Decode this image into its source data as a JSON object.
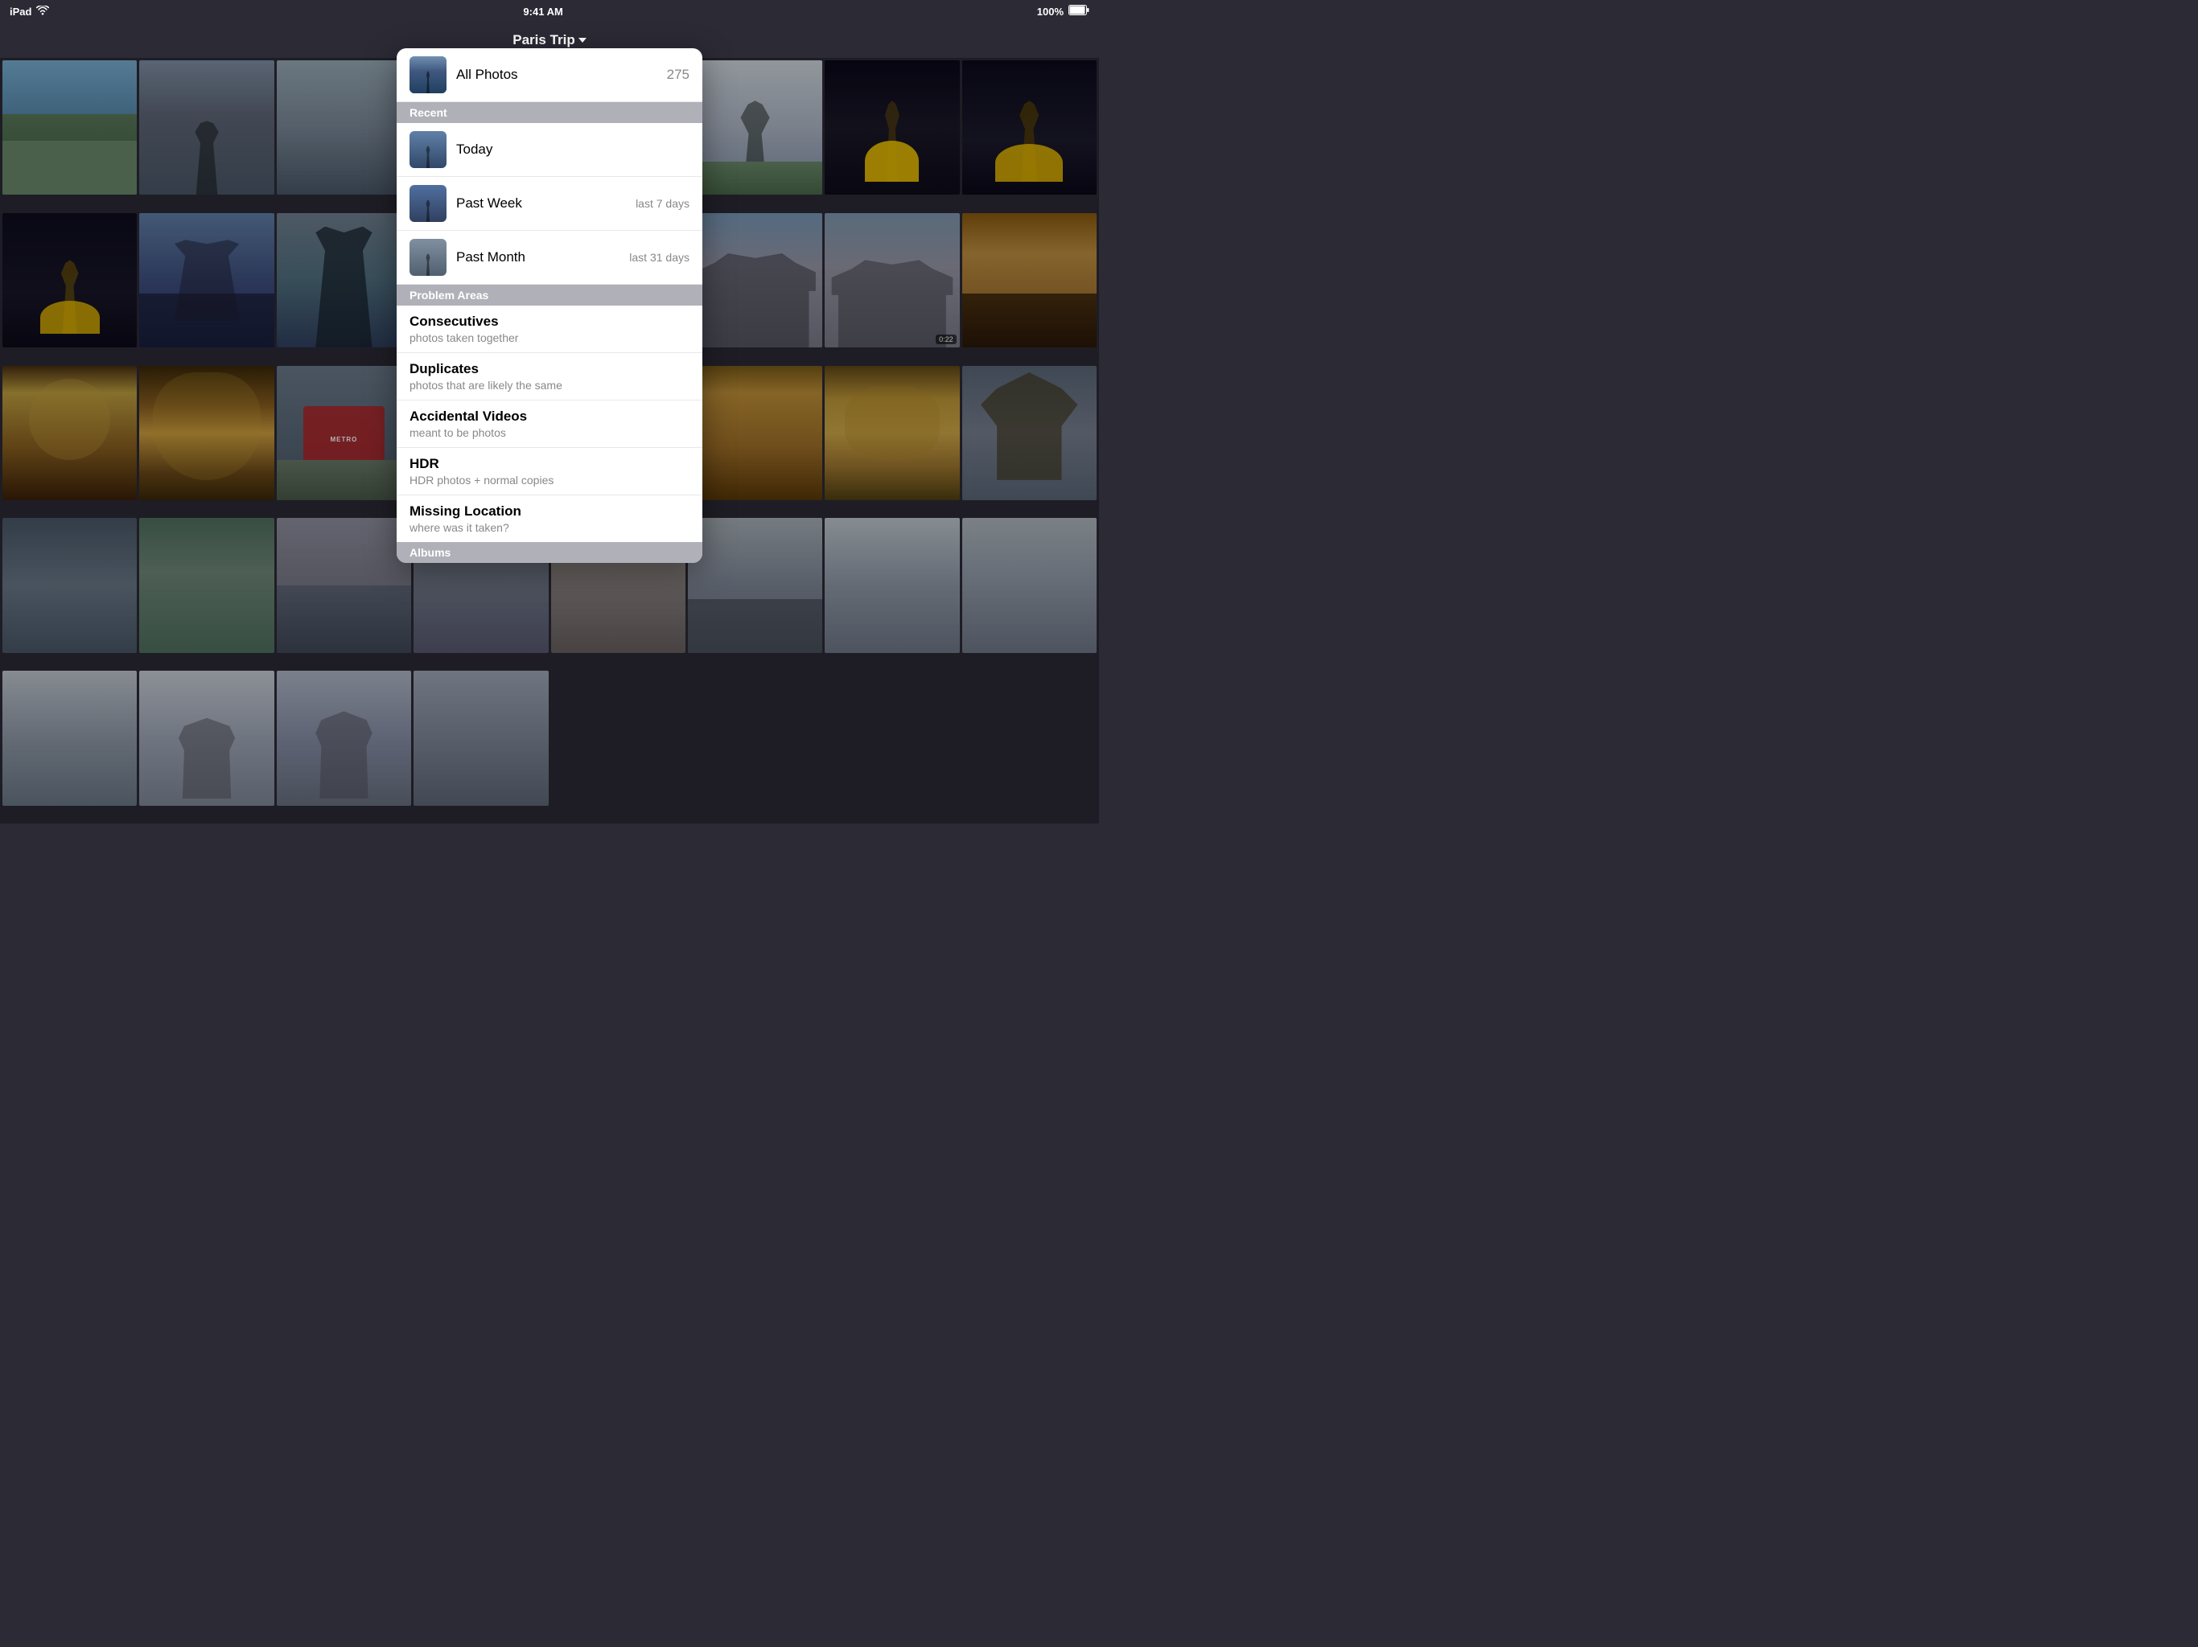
{
  "statusBar": {
    "device": "iPad",
    "time": "9:41 AM",
    "battery": "100%"
  },
  "titleBar": {
    "title": "Paris Trip",
    "chevron": "▾"
  },
  "dropdown": {
    "allPhotos": {
      "label": "All Photos",
      "count": "275"
    },
    "recentSection": {
      "header": "Recent",
      "items": [
        {
          "label": "Today",
          "meta": ""
        },
        {
          "label": "Past Week",
          "meta": "last 7 days"
        },
        {
          "label": "Past Month",
          "meta": "last 31 days"
        }
      ]
    },
    "problemSection": {
      "header": "Problem Areas",
      "items": [
        {
          "label": "Consecutives",
          "sub": "photos taken together"
        },
        {
          "label": "Duplicates",
          "sub": "photos that are likely the same"
        },
        {
          "label": "Accidental Videos",
          "sub": "meant to be photos"
        },
        {
          "label": "HDR",
          "sub": "HDR photos + normal copies"
        },
        {
          "label": "Missing Location",
          "sub": "where was it taken?"
        }
      ]
    },
    "albumsSection": {
      "header": "Albums"
    }
  },
  "grid": {
    "cells": [
      {
        "type": "sky",
        "row": 0,
        "col": 0
      },
      {
        "type": "sky",
        "row": 0,
        "col": 1
      },
      {
        "type": "building",
        "row": 0,
        "col": 2
      },
      {
        "type": "sky",
        "row": 0,
        "col": 3
      },
      {
        "type": "sky",
        "row": 0,
        "col": 4
      },
      {
        "type": "sky",
        "row": 0,
        "col": 5
      }
    ]
  }
}
